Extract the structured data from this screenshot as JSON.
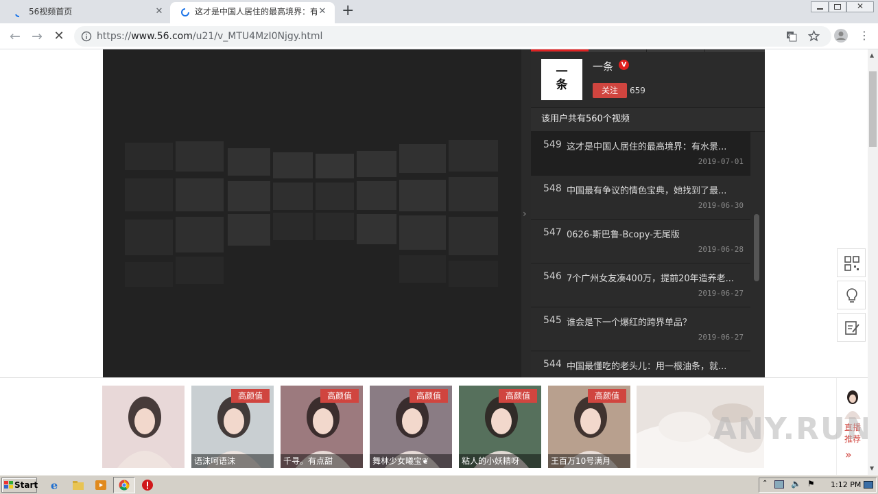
{
  "browser": {
    "tabs": [
      {
        "title": "56视频首页",
        "active": false
      },
      {
        "title": "这才是中国人居住的最高境界：有水景",
        "active": true
      }
    ],
    "url_prefix": "https://",
    "url_host": "www.56.com",
    "url_path": "/u21/v_MTU4MzI0Njgy.html"
  },
  "author": {
    "avatar_text": "一条",
    "name": "一条",
    "vip_badge": "V",
    "follow_label": "关注",
    "followers": "659"
  },
  "video_count_text": "该用户共有560个视频",
  "videos": [
    {
      "num": "549",
      "title": "这才是中国人居住的最高境界：有水景...",
      "date": "2019-07-01",
      "current": true
    },
    {
      "num": "548",
      "title": "中国最有争议的情色宝典，她找到了最...",
      "date": "2019-06-30",
      "current": false
    },
    {
      "num": "547",
      "title": "0626-斯巴鲁-Bcopy-无尾版",
      "date": "2019-06-28",
      "current": false
    },
    {
      "num": "546",
      "title": "7个广州女友凑400万，提前20年造养老...",
      "date": "2019-06-27",
      "current": false
    },
    {
      "num": "545",
      "title": "谁会是下一个爆红的跨界单品？",
      "date": "2019-06-27",
      "current": false
    },
    {
      "num": "544",
      "title": "中国最懂吃的老头儿：用一根油条，就...",
      "date": "",
      "current": false
    }
  ],
  "recommend": [
    {
      "tag": "",
      "name": "",
      "color": "#e8d8d8"
    },
    {
      "tag": "高颜值",
      "name": "语沫呵语沫",
      "color": "#c9cfd2"
    },
    {
      "tag": "高颜值",
      "name": "千寻。有点甜",
      "color": "#9c7a7e"
    },
    {
      "tag": "高颜值",
      "name": "舞林少女曦宝❦",
      "color": "#8a7c84"
    },
    {
      "tag": "高颜值",
      "name": "粘人的小妖精呀",
      "color": "#56705c"
    },
    {
      "tag": "高颜值",
      "name": "王百万10号满月",
      "color": "#b8a08e"
    }
  ],
  "live_label": "直播推荐",
  "live_arrow": "»",
  "taskbar": {
    "start_label": "Start",
    "clock": "1:12 PM"
  },
  "watermark": "ANY.RUN"
}
